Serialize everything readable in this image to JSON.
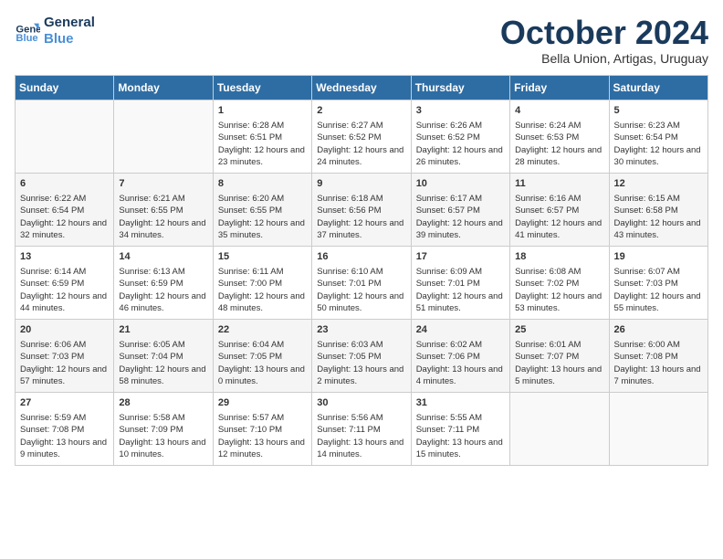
{
  "logo": {
    "line1": "General",
    "line2": "Blue"
  },
  "title": "October 2024",
  "subtitle": "Bella Union, Artigas, Uruguay",
  "days_of_week": [
    "Sunday",
    "Monday",
    "Tuesday",
    "Wednesday",
    "Thursday",
    "Friday",
    "Saturday"
  ],
  "weeks": [
    [
      {
        "day": "",
        "sunrise": "",
        "sunset": "",
        "daylight": ""
      },
      {
        "day": "",
        "sunrise": "",
        "sunset": "",
        "daylight": ""
      },
      {
        "day": "1",
        "sunrise": "Sunrise: 6:28 AM",
        "sunset": "Sunset: 6:51 PM",
        "daylight": "Daylight: 12 hours and 23 minutes."
      },
      {
        "day": "2",
        "sunrise": "Sunrise: 6:27 AM",
        "sunset": "Sunset: 6:52 PM",
        "daylight": "Daylight: 12 hours and 24 minutes."
      },
      {
        "day": "3",
        "sunrise": "Sunrise: 6:26 AM",
        "sunset": "Sunset: 6:52 PM",
        "daylight": "Daylight: 12 hours and 26 minutes."
      },
      {
        "day": "4",
        "sunrise": "Sunrise: 6:24 AM",
        "sunset": "Sunset: 6:53 PM",
        "daylight": "Daylight: 12 hours and 28 minutes."
      },
      {
        "day": "5",
        "sunrise": "Sunrise: 6:23 AM",
        "sunset": "Sunset: 6:54 PM",
        "daylight": "Daylight: 12 hours and 30 minutes."
      }
    ],
    [
      {
        "day": "6",
        "sunrise": "Sunrise: 6:22 AM",
        "sunset": "Sunset: 6:54 PM",
        "daylight": "Daylight: 12 hours and 32 minutes."
      },
      {
        "day": "7",
        "sunrise": "Sunrise: 6:21 AM",
        "sunset": "Sunset: 6:55 PM",
        "daylight": "Daylight: 12 hours and 34 minutes."
      },
      {
        "day": "8",
        "sunrise": "Sunrise: 6:20 AM",
        "sunset": "Sunset: 6:55 PM",
        "daylight": "Daylight: 12 hours and 35 minutes."
      },
      {
        "day": "9",
        "sunrise": "Sunrise: 6:18 AM",
        "sunset": "Sunset: 6:56 PM",
        "daylight": "Daylight: 12 hours and 37 minutes."
      },
      {
        "day": "10",
        "sunrise": "Sunrise: 6:17 AM",
        "sunset": "Sunset: 6:57 PM",
        "daylight": "Daylight: 12 hours and 39 minutes."
      },
      {
        "day": "11",
        "sunrise": "Sunrise: 6:16 AM",
        "sunset": "Sunset: 6:57 PM",
        "daylight": "Daylight: 12 hours and 41 minutes."
      },
      {
        "day": "12",
        "sunrise": "Sunrise: 6:15 AM",
        "sunset": "Sunset: 6:58 PM",
        "daylight": "Daylight: 12 hours and 43 minutes."
      }
    ],
    [
      {
        "day": "13",
        "sunrise": "Sunrise: 6:14 AM",
        "sunset": "Sunset: 6:59 PM",
        "daylight": "Daylight: 12 hours and 44 minutes."
      },
      {
        "day": "14",
        "sunrise": "Sunrise: 6:13 AM",
        "sunset": "Sunset: 6:59 PM",
        "daylight": "Daylight: 12 hours and 46 minutes."
      },
      {
        "day": "15",
        "sunrise": "Sunrise: 6:11 AM",
        "sunset": "Sunset: 7:00 PM",
        "daylight": "Daylight: 12 hours and 48 minutes."
      },
      {
        "day": "16",
        "sunrise": "Sunrise: 6:10 AM",
        "sunset": "Sunset: 7:01 PM",
        "daylight": "Daylight: 12 hours and 50 minutes."
      },
      {
        "day": "17",
        "sunrise": "Sunrise: 6:09 AM",
        "sunset": "Sunset: 7:01 PM",
        "daylight": "Daylight: 12 hours and 51 minutes."
      },
      {
        "day": "18",
        "sunrise": "Sunrise: 6:08 AM",
        "sunset": "Sunset: 7:02 PM",
        "daylight": "Daylight: 12 hours and 53 minutes."
      },
      {
        "day": "19",
        "sunrise": "Sunrise: 6:07 AM",
        "sunset": "Sunset: 7:03 PM",
        "daylight": "Daylight: 12 hours and 55 minutes."
      }
    ],
    [
      {
        "day": "20",
        "sunrise": "Sunrise: 6:06 AM",
        "sunset": "Sunset: 7:03 PM",
        "daylight": "Daylight: 12 hours and 57 minutes."
      },
      {
        "day": "21",
        "sunrise": "Sunrise: 6:05 AM",
        "sunset": "Sunset: 7:04 PM",
        "daylight": "Daylight: 12 hours and 58 minutes."
      },
      {
        "day": "22",
        "sunrise": "Sunrise: 6:04 AM",
        "sunset": "Sunset: 7:05 PM",
        "daylight": "Daylight: 13 hours and 0 minutes."
      },
      {
        "day": "23",
        "sunrise": "Sunrise: 6:03 AM",
        "sunset": "Sunset: 7:05 PM",
        "daylight": "Daylight: 13 hours and 2 minutes."
      },
      {
        "day": "24",
        "sunrise": "Sunrise: 6:02 AM",
        "sunset": "Sunset: 7:06 PM",
        "daylight": "Daylight: 13 hours and 4 minutes."
      },
      {
        "day": "25",
        "sunrise": "Sunrise: 6:01 AM",
        "sunset": "Sunset: 7:07 PM",
        "daylight": "Daylight: 13 hours and 5 minutes."
      },
      {
        "day": "26",
        "sunrise": "Sunrise: 6:00 AM",
        "sunset": "Sunset: 7:08 PM",
        "daylight": "Daylight: 13 hours and 7 minutes."
      }
    ],
    [
      {
        "day": "27",
        "sunrise": "Sunrise: 5:59 AM",
        "sunset": "Sunset: 7:08 PM",
        "daylight": "Daylight: 13 hours and 9 minutes."
      },
      {
        "day": "28",
        "sunrise": "Sunrise: 5:58 AM",
        "sunset": "Sunset: 7:09 PM",
        "daylight": "Daylight: 13 hours and 10 minutes."
      },
      {
        "day": "29",
        "sunrise": "Sunrise: 5:57 AM",
        "sunset": "Sunset: 7:10 PM",
        "daylight": "Daylight: 13 hours and 12 minutes."
      },
      {
        "day": "30",
        "sunrise": "Sunrise: 5:56 AM",
        "sunset": "Sunset: 7:11 PM",
        "daylight": "Daylight: 13 hours and 14 minutes."
      },
      {
        "day": "31",
        "sunrise": "Sunrise: 5:55 AM",
        "sunset": "Sunset: 7:11 PM",
        "daylight": "Daylight: 13 hours and 15 minutes."
      },
      {
        "day": "",
        "sunrise": "",
        "sunset": "",
        "daylight": ""
      },
      {
        "day": "",
        "sunrise": "",
        "sunset": "",
        "daylight": ""
      }
    ]
  ]
}
